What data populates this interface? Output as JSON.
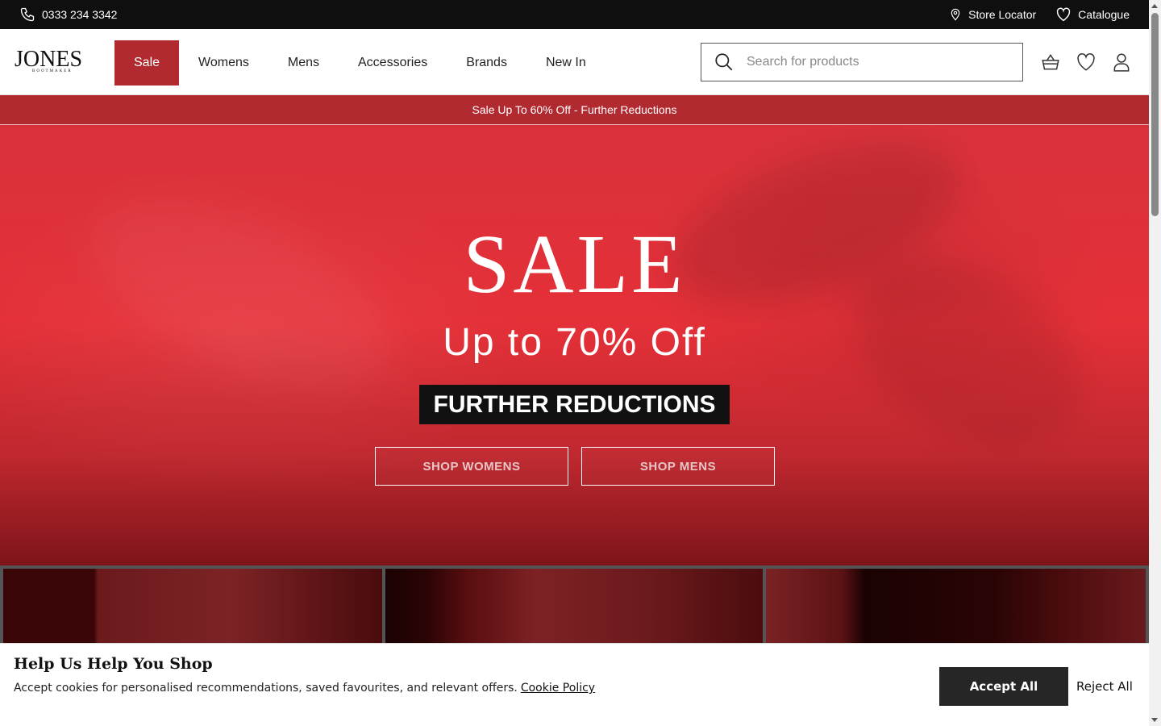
{
  "topbar": {
    "phone": "0333 234 3342",
    "phone_icon": "phone-icon",
    "store_locator": "Store Locator",
    "store_locator_icon": "map-pin-icon",
    "catalogue": "Catalogue",
    "catalogue_icon": "heart-icon"
  },
  "header": {
    "logo_text": "JONES",
    "logo_sub": "BOOTMAKER",
    "nav": [
      {
        "label": "Sale"
      },
      {
        "label": "Womens"
      },
      {
        "label": "Mens"
      },
      {
        "label": "Accessories"
      },
      {
        "label": "Brands"
      },
      {
        "label": "New In"
      }
    ],
    "search_placeholder": "Search for products",
    "icons": [
      "basket-icon",
      "wishlist-icon",
      "account-icon"
    ]
  },
  "promo": {
    "text": "Sale Up To 60% Off - Further Reductions"
  },
  "hero": {
    "title": "SALE",
    "subtitle": "Up to 70% Off",
    "tag": "FURTHER REDUCTIONS",
    "shop_womens": "SHOP WOMENS",
    "shop_mens": "SHOP MENS"
  },
  "cookie": {
    "title": "Help Us Help You Shop",
    "text": "Accept cookies for personalised recommendations, saved favourites, and relevant offers.",
    "policy_link": "Cookie Policy",
    "accept": "Accept All",
    "reject": "Reject All"
  },
  "colors": {
    "topbar_bg": "#0f0f0f",
    "accent": "#b02a30",
    "hero_red": "#e53038",
    "button_dark": "#262626"
  }
}
